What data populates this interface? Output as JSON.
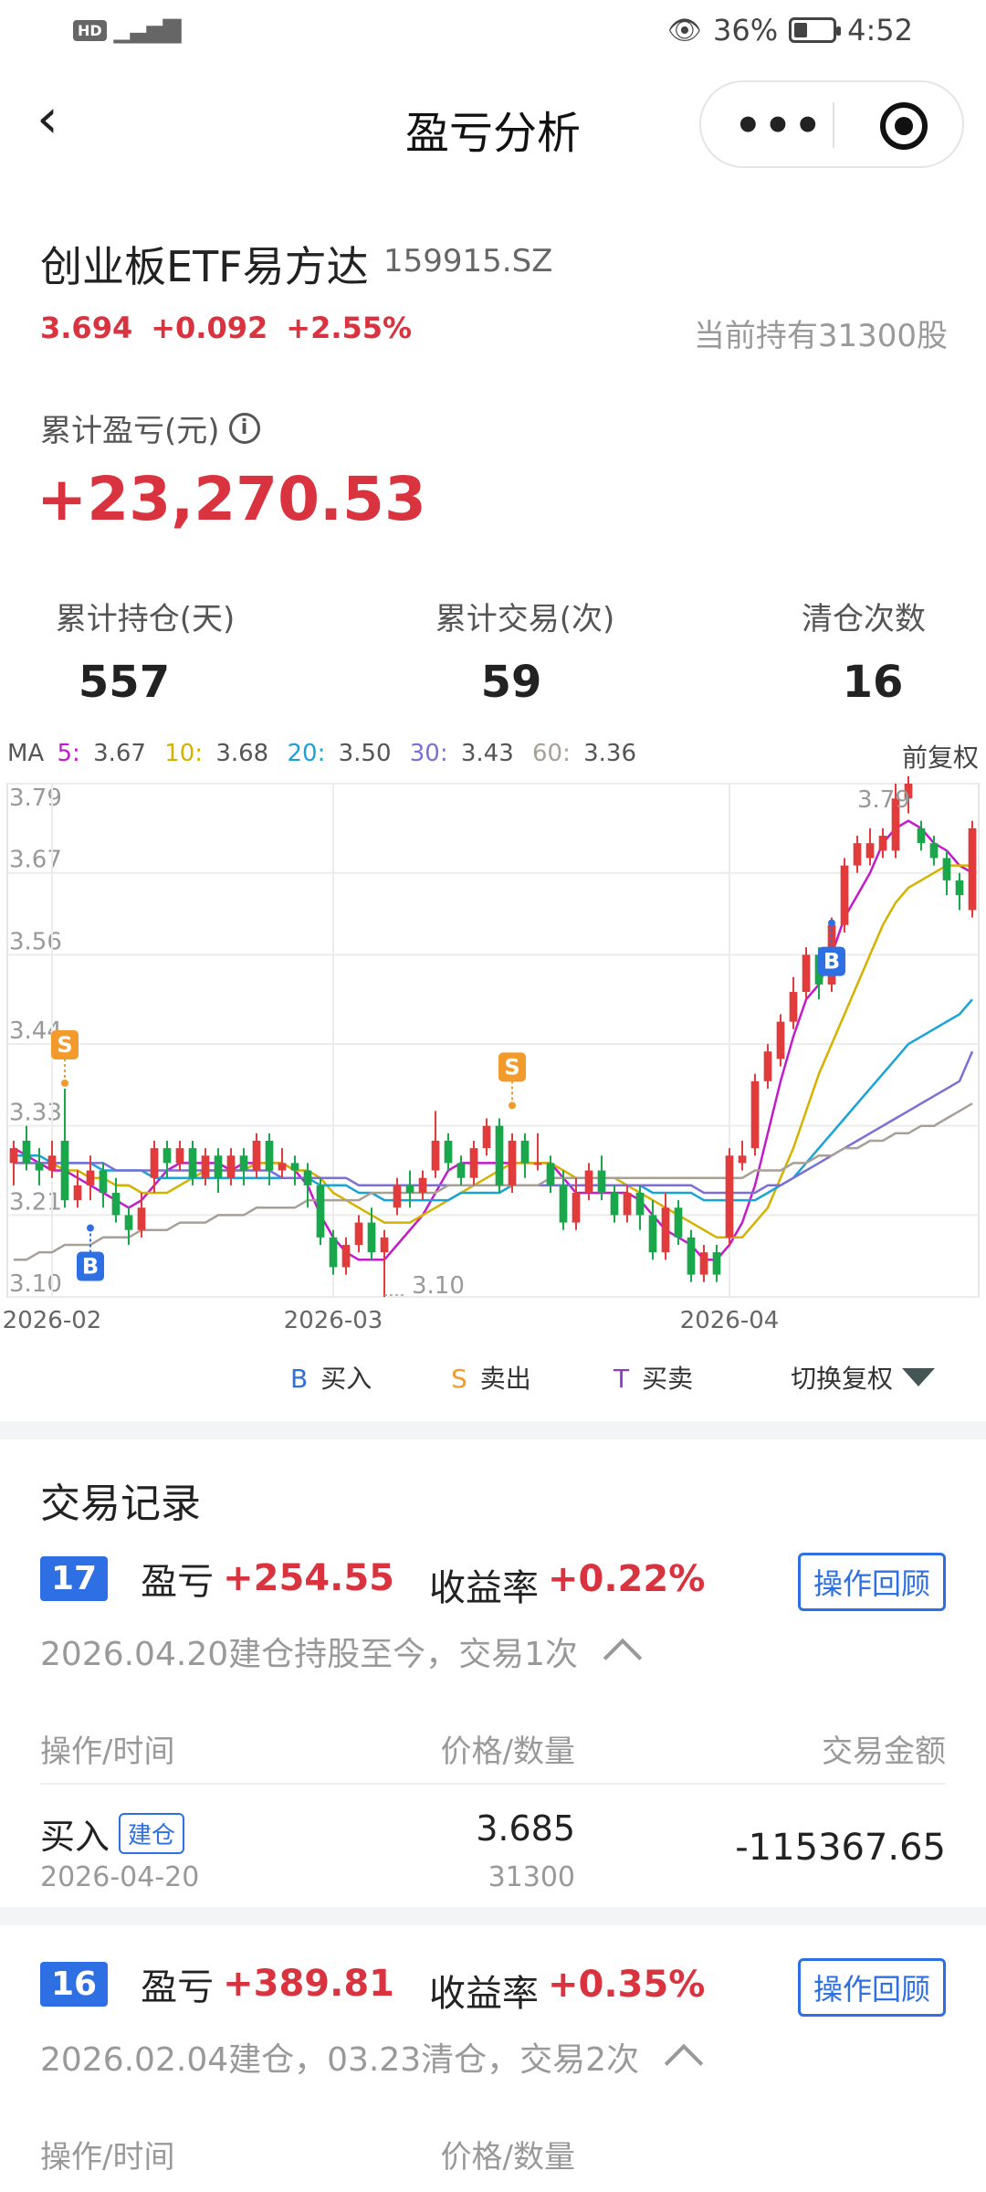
{
  "status_bar": {
    "hd": "HD",
    "signal": "4G",
    "battery_pct": "36%",
    "battery_level": 0.36,
    "time": "4:52"
  },
  "nav": {
    "title": "盈亏分析"
  },
  "stock": {
    "name": "创业板ETF易方达",
    "code": "159915.SZ",
    "price": "3.694",
    "change": "+0.092",
    "change_pct": "+2.55%",
    "holding": "当前持有31300股"
  },
  "pnl": {
    "label": "累计盈亏(元)",
    "value": "+23,270.53"
  },
  "stats": [
    {
      "label": "累计持仓(天)",
      "value": "557"
    },
    {
      "label": "累计交易(次)",
      "value": "59"
    },
    {
      "label": "清仓次数",
      "value": "16"
    }
  ],
  "ma": {
    "label": "MA",
    "items": [
      {
        "key": "5:",
        "value": "3.67",
        "color": "#c21bc9"
      },
      {
        "key": "10:",
        "value": "3.68",
        "color": "#d4b300"
      },
      {
        "key": "20:",
        "value": "3.50",
        "color": "#1aa3d9"
      },
      {
        "key": "30:",
        "value": "3.43",
        "color": "#7b6fd6"
      },
      {
        "key": "60:",
        "value": "3.36",
        "color": "#a89f96"
      }
    ],
    "fq": "前复权"
  },
  "chart_data": {
    "type": "candlestick",
    "y_ticks": [
      "3.79",
      "3.67",
      "3.56",
      "3.44",
      "3.33",
      "3.21",
      "3.10"
    ],
    "x_ticks": [
      "2026-02",
      "2026-03",
      "2026-04"
    ],
    "ylim": [
      3.1,
      3.79
    ],
    "high_label": "3.79",
    "low_label": "3.10",
    "up_color": "#e13b3b",
    "down_color": "#1aa64a",
    "candles": [
      [
        3.28,
        3.3,
        3.25,
        3.31
      ],
      [
        3.31,
        3.28,
        3.27,
        3.33
      ],
      [
        3.28,
        3.27,
        3.25,
        3.3
      ],
      [
        3.27,
        3.29,
        3.26,
        3.31
      ],
      [
        3.31,
        3.23,
        3.22,
        3.38
      ],
      [
        3.23,
        3.25,
        3.22,
        3.27
      ],
      [
        3.25,
        3.27,
        3.23,
        3.29
      ],
      [
        3.27,
        3.24,
        3.22,
        3.28
      ],
      [
        3.24,
        3.21,
        3.2,
        3.26
      ],
      [
        3.21,
        3.19,
        3.17,
        3.22
      ],
      [
        3.19,
        3.22,
        3.18,
        3.24
      ],
      [
        3.26,
        3.3,
        3.24,
        3.31
      ],
      [
        3.3,
        3.28,
        3.26,
        3.31
      ],
      [
        3.28,
        3.3,
        3.27,
        3.31
      ],
      [
        3.3,
        3.26,
        3.25,
        3.31
      ],
      [
        3.26,
        3.29,
        3.25,
        3.3
      ],
      [
        3.29,
        3.26,
        3.24,
        3.3
      ],
      [
        3.26,
        3.29,
        3.25,
        3.3
      ],
      [
        3.29,
        3.27,
        3.25,
        3.3
      ],
      [
        3.27,
        3.31,
        3.26,
        3.32
      ],
      [
        3.31,
        3.27,
        3.25,
        3.32
      ],
      [
        3.27,
        3.28,
        3.26,
        3.3
      ],
      [
        3.28,
        3.27,
        3.25,
        3.29
      ],
      [
        3.27,
        3.25,
        3.22,
        3.28
      ],
      [
        3.25,
        3.18,
        3.17,
        3.26
      ],
      [
        3.18,
        3.14,
        3.13,
        3.19
      ],
      [
        3.14,
        3.17,
        3.13,
        3.18
      ],
      [
        3.17,
        3.2,
        3.16,
        3.21
      ],
      [
        3.2,
        3.16,
        3.15,
        3.22
      ],
      [
        3.16,
        3.18,
        3.1,
        3.19
      ],
      [
        3.22,
        3.25,
        3.21,
        3.26
      ],
      [
        3.25,
        3.24,
        3.22,
        3.27
      ],
      [
        3.24,
        3.26,
        3.23,
        3.27
      ],
      [
        3.27,
        3.31,
        3.26,
        3.35
      ],
      [
        3.31,
        3.28,
        3.27,
        3.32
      ],
      [
        3.28,
        3.26,
        3.25,
        3.29
      ],
      [
        3.26,
        3.3,
        3.25,
        3.31
      ],
      [
        3.3,
        3.33,
        3.29,
        3.34
      ],
      [
        3.33,
        3.25,
        3.24,
        3.34
      ],
      [
        3.25,
        3.31,
        3.24,
        3.32
      ],
      [
        3.31,
        3.28,
        3.26,
        3.32
      ],
      [
        3.28,
        3.28,
        3.27,
        3.32
      ],
      [
        3.28,
        3.25,
        3.24,
        3.29
      ],
      [
        3.25,
        3.2,
        3.19,
        3.27
      ],
      [
        3.2,
        3.24,
        3.19,
        3.26
      ],
      [
        3.24,
        3.27,
        3.23,
        3.28
      ],
      [
        3.27,
        3.24,
        3.23,
        3.29
      ],
      [
        3.24,
        3.21,
        3.2,
        3.25
      ],
      [
        3.21,
        3.24,
        3.2,
        3.25
      ],
      [
        3.24,
        3.21,
        3.19,
        3.25
      ],
      [
        3.21,
        3.16,
        3.15,
        3.23
      ],
      [
        3.16,
        3.22,
        3.15,
        3.24
      ],
      [
        3.22,
        3.18,
        3.17,
        3.23
      ],
      [
        3.18,
        3.13,
        3.12,
        3.19
      ],
      [
        3.13,
        3.16,
        3.12,
        3.17
      ],
      [
        3.16,
        3.13,
        3.12,
        3.17
      ],
      [
        3.18,
        3.29,
        3.17,
        3.3
      ],
      [
        3.28,
        3.29,
        3.27,
        3.31
      ],
      [
        3.3,
        3.39,
        3.29,
        3.4
      ],
      [
        3.39,
        3.43,
        3.38,
        3.44
      ],
      [
        3.42,
        3.47,
        3.41,
        3.48
      ],
      [
        3.47,
        3.51,
        3.46,
        3.53
      ],
      [
        3.51,
        3.56,
        3.5,
        3.57
      ],
      [
        3.56,
        3.52,
        3.5,
        3.57
      ],
      [
        3.52,
        3.6,
        3.51,
        3.61
      ],
      [
        3.6,
        3.68,
        3.59,
        3.69
      ],
      [
        3.68,
        3.71,
        3.67,
        3.72
      ],
      [
        3.69,
        3.71,
        3.68,
        3.73
      ],
      [
        3.7,
        3.72,
        3.69,
        3.73
      ],
      [
        3.7,
        3.77,
        3.69,
        3.79
      ],
      [
        3.77,
        3.79,
        3.75,
        3.8
      ],
      [
        3.73,
        3.71,
        3.7,
        3.74
      ],
      [
        3.71,
        3.69,
        3.68,
        3.72
      ],
      [
        3.69,
        3.66,
        3.64,
        3.7
      ],
      [
        3.66,
        3.64,
        3.62,
        3.67
      ],
      [
        3.62,
        3.73,
        3.61,
        3.74
      ]
    ],
    "ma_series": [
      {
        "name": "MA5",
        "color": "#c21bc9",
        "values": [
          3.3,
          3.29,
          3.28,
          3.27,
          3.27,
          3.26,
          3.25,
          3.24,
          3.23,
          3.22,
          3.23,
          3.25,
          3.27,
          3.28,
          3.28,
          3.28,
          3.28,
          3.27,
          3.28,
          3.28,
          3.28,
          3.28,
          3.27,
          3.25,
          3.21,
          3.18,
          3.16,
          3.15,
          3.15,
          3.15,
          3.17,
          3.19,
          3.21,
          3.24,
          3.27,
          3.28,
          3.28,
          3.28,
          3.28,
          3.28,
          3.28,
          3.28,
          3.28,
          3.26,
          3.24,
          3.24,
          3.24,
          3.24,
          3.24,
          3.23,
          3.21,
          3.19,
          3.18,
          3.17,
          3.15,
          3.15,
          3.17,
          3.2,
          3.25,
          3.32,
          3.39,
          3.45,
          3.5,
          3.52,
          3.56,
          3.61,
          3.64,
          3.67,
          3.71,
          3.73,
          3.74,
          3.73,
          3.71,
          3.7,
          3.68,
          3.67
        ]
      },
      {
        "name": "MA10",
        "color": "#d4b300",
        "values": [
          3.28,
          3.28,
          3.28,
          3.28,
          3.27,
          3.27,
          3.26,
          3.26,
          3.25,
          3.25,
          3.24,
          3.24,
          3.24,
          3.25,
          3.26,
          3.27,
          3.27,
          3.27,
          3.27,
          3.28,
          3.28,
          3.28,
          3.27,
          3.27,
          3.26,
          3.24,
          3.23,
          3.22,
          3.21,
          3.2,
          3.2,
          3.2,
          3.21,
          3.22,
          3.23,
          3.24,
          3.25,
          3.26,
          3.27,
          3.28,
          3.28,
          3.28,
          3.28,
          3.27,
          3.26,
          3.26,
          3.26,
          3.26,
          3.25,
          3.24,
          3.23,
          3.22,
          3.21,
          3.2,
          3.19,
          3.18,
          3.18,
          3.18,
          3.2,
          3.22,
          3.26,
          3.3,
          3.35,
          3.4,
          3.44,
          3.48,
          3.52,
          3.56,
          3.6,
          3.63,
          3.65,
          3.66,
          3.67,
          3.68,
          3.68,
          3.68
        ]
      },
      {
        "name": "MA20",
        "color": "#1aa3d9",
        "values": [
          3.29,
          3.29,
          3.29,
          3.28,
          3.28,
          3.28,
          3.28,
          3.27,
          3.27,
          3.27,
          3.27,
          3.26,
          3.26,
          3.26,
          3.26,
          3.26,
          3.26,
          3.26,
          3.26,
          3.26,
          3.26,
          3.26,
          3.26,
          3.26,
          3.25,
          3.25,
          3.25,
          3.24,
          3.24,
          3.23,
          3.23,
          3.23,
          3.23,
          3.23,
          3.23,
          3.24,
          3.24,
          3.24,
          3.24,
          3.25,
          3.25,
          3.25,
          3.25,
          3.25,
          3.25,
          3.25,
          3.25,
          3.25,
          3.25,
          3.25,
          3.24,
          3.24,
          3.24,
          3.24,
          3.23,
          3.23,
          3.23,
          3.23,
          3.23,
          3.24,
          3.25,
          3.26,
          3.28,
          3.3,
          3.32,
          3.34,
          3.36,
          3.38,
          3.4,
          3.42,
          3.44,
          3.45,
          3.46,
          3.47,
          3.48,
          3.5
        ]
      },
      {
        "name": "MA30",
        "color": "#7b6fd6",
        "values": [
          3.28,
          3.28,
          3.28,
          3.28,
          3.28,
          3.28,
          3.28,
          3.28,
          3.27,
          3.27,
          3.27,
          3.27,
          3.27,
          3.27,
          3.27,
          3.27,
          3.27,
          3.27,
          3.27,
          3.27,
          3.27,
          3.26,
          3.26,
          3.26,
          3.26,
          3.26,
          3.26,
          3.25,
          3.25,
          3.25,
          3.25,
          3.25,
          3.25,
          3.25,
          3.25,
          3.25,
          3.25,
          3.25,
          3.25,
          3.25,
          3.25,
          3.25,
          3.25,
          3.25,
          3.25,
          3.25,
          3.25,
          3.25,
          3.25,
          3.25,
          3.25,
          3.25,
          3.25,
          3.25,
          3.24,
          3.24,
          3.24,
          3.24,
          3.24,
          3.25,
          3.25,
          3.26,
          3.27,
          3.28,
          3.29,
          3.3,
          3.31,
          3.32,
          3.33,
          3.34,
          3.35,
          3.36,
          3.37,
          3.38,
          3.39,
          3.43
        ]
      },
      {
        "name": "MA60",
        "color": "#a89f96",
        "values": [
          3.15,
          3.15,
          3.16,
          3.16,
          3.17,
          3.17,
          3.17,
          3.18,
          3.18,
          3.18,
          3.19,
          3.19,
          3.19,
          3.2,
          3.2,
          3.2,
          3.21,
          3.21,
          3.21,
          3.22,
          3.22,
          3.22,
          3.22,
          3.23,
          3.23,
          3.23,
          3.23,
          3.23,
          3.24,
          3.24,
          3.24,
          3.24,
          3.24,
          3.24,
          3.25,
          3.25,
          3.25,
          3.25,
          3.25,
          3.25,
          3.25,
          3.25,
          3.26,
          3.26,
          3.26,
          3.26,
          3.26,
          3.26,
          3.26,
          3.26,
          3.26,
          3.26,
          3.26,
          3.26,
          3.26,
          3.26,
          3.26,
          3.26,
          3.27,
          3.27,
          3.27,
          3.28,
          3.28,
          3.29,
          3.29,
          3.3,
          3.3,
          3.31,
          3.31,
          3.32,
          3.32,
          3.33,
          3.33,
          3.34,
          3.35,
          3.36
        ]
      }
    ],
    "markers": [
      {
        "type": "B",
        "index": 6,
        "price": 3.2,
        "pos": "below",
        "color": "#2f6fe4"
      },
      {
        "type": "S",
        "index": 4,
        "price": 3.38,
        "pos": "above",
        "color": "#f39a2c"
      },
      {
        "type": "S",
        "index": 39,
        "price": 3.35,
        "pos": "above",
        "color": "#f39a2c"
      },
      {
        "type": "B",
        "index": 64,
        "price": 3.61,
        "pos": "below",
        "color": "#2f6fe4"
      }
    ]
  },
  "legend": {
    "buy": {
      "code": "B",
      "label": "买入",
      "color": "#2f6fe4"
    },
    "sell": {
      "code": "S",
      "label": "卖出",
      "color": "#f39a2c"
    },
    "trade": {
      "code": "T",
      "label": "买卖",
      "color": "#8a3cc9"
    },
    "switch": "切换复权"
  },
  "records": {
    "title": "交易记录",
    "items": [
      {
        "index": "17",
        "pl_label": "盈亏",
        "pl_value": "+254.55",
        "rate_label": "收益率",
        "rate_value": "+0.22%",
        "replay": "操作回顾",
        "summary": "2026.04.20建仓持股至今，交易1次",
        "headers": {
          "action": "操作/时间",
          "price": "价格/数量",
          "amount": "交易金额"
        },
        "trades": [
          {
            "action": "买入",
            "tag": "建仓",
            "date": "2026-04-20",
            "price": "3.685",
            "qty": "31300",
            "amount": "-115367.65"
          }
        ]
      },
      {
        "index": "16",
        "pl_label": "盈亏",
        "pl_value": "+389.81",
        "rate_label": "收益率",
        "rate_value": "+0.35%",
        "replay": "操作回顾",
        "summary": "2026.02.04建仓，03.23清仓，交易2次",
        "headers": {
          "action": "操作/时间",
          "price": "价格/数量"
        }
      }
    ]
  }
}
